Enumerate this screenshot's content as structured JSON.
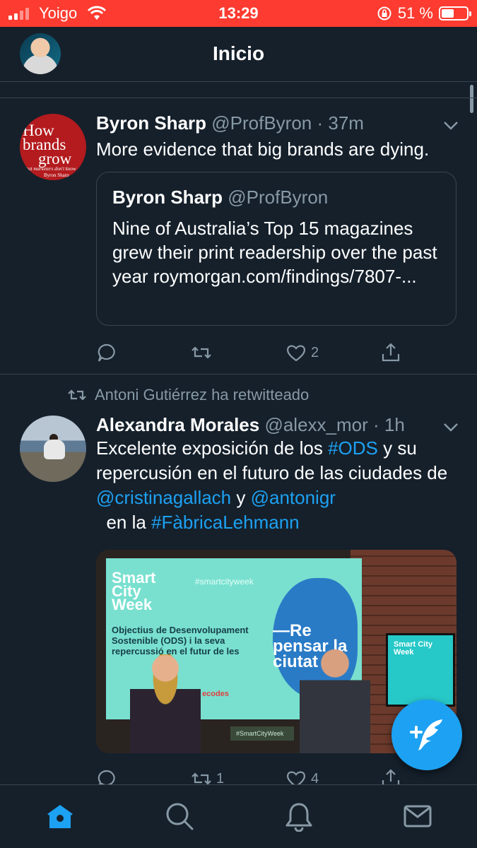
{
  "status_bar": {
    "carrier": "Yoigo",
    "time": "13:29",
    "battery_percent": "51 %",
    "battery_level": 0.51,
    "background_color": "#fd3b30"
  },
  "header": {
    "title": "Inicio",
    "avatar_icon": "profile-avatar"
  },
  "theme": {
    "background": "#15202b",
    "border": "#38444d",
    "secondary_text": "#8899a6",
    "accent": "#1da1f2"
  },
  "tweets": [
    {
      "avatar_text": [
        "How",
        "brands",
        "grow",
        "what marketers don't know",
        "Byron Sharp"
      ],
      "name": "Byron Sharp",
      "handle": "@ProfByron",
      "time": "· 37m",
      "text": "More evidence that big brands are dying.",
      "quote": {
        "name": "Byron Sharp",
        "handle": "@ProfByron",
        "text": "Nine of Australia’s Top 15 magazines grew their print readership over the past year roymorgan.com/findings/7807-..."
      },
      "actions": {
        "reply_count": "",
        "retweet_count": "",
        "like_count": "2"
      }
    },
    {
      "retweeted_by": "Antoni Gutiérrez ha retwitteado",
      "name": "Alexandra Morales",
      "handle": "@alexx_mor",
      "time": "· 1h",
      "text_parts": {
        "p1": "Excelente exposición de los ",
        "tag1": "#ODS",
        "p2": " y su repercusión en el futuro de las ciudades de ",
        "mention1": "@cristinagallach",
        "p3": " y ",
        "mention2": "@antonigr",
        "p4": "  en la ",
        "tag2": "#FàbricaLehmann"
      },
      "media": {
        "logo": "Smart City Week",
        "hashtag": "#smartcityweek",
        "objective": "Objectius de Desenvolupament Sostenible (ODS) i la seva repercussió en el futur de les",
        "slogan": "—Re pensar la ciutat",
        "ecodes": "ecodes",
        "tv_text": "Smart City Week",
        "table_text": "#SmartCityWeek"
      },
      "actions": {
        "reply_count": "",
        "retweet_count": "1",
        "like_count": "4"
      }
    }
  ],
  "compose_button": {
    "icon": "compose-feather-icon"
  },
  "tab_bar": {
    "items": [
      "home",
      "search",
      "notifications",
      "messages"
    ],
    "active": "home"
  }
}
